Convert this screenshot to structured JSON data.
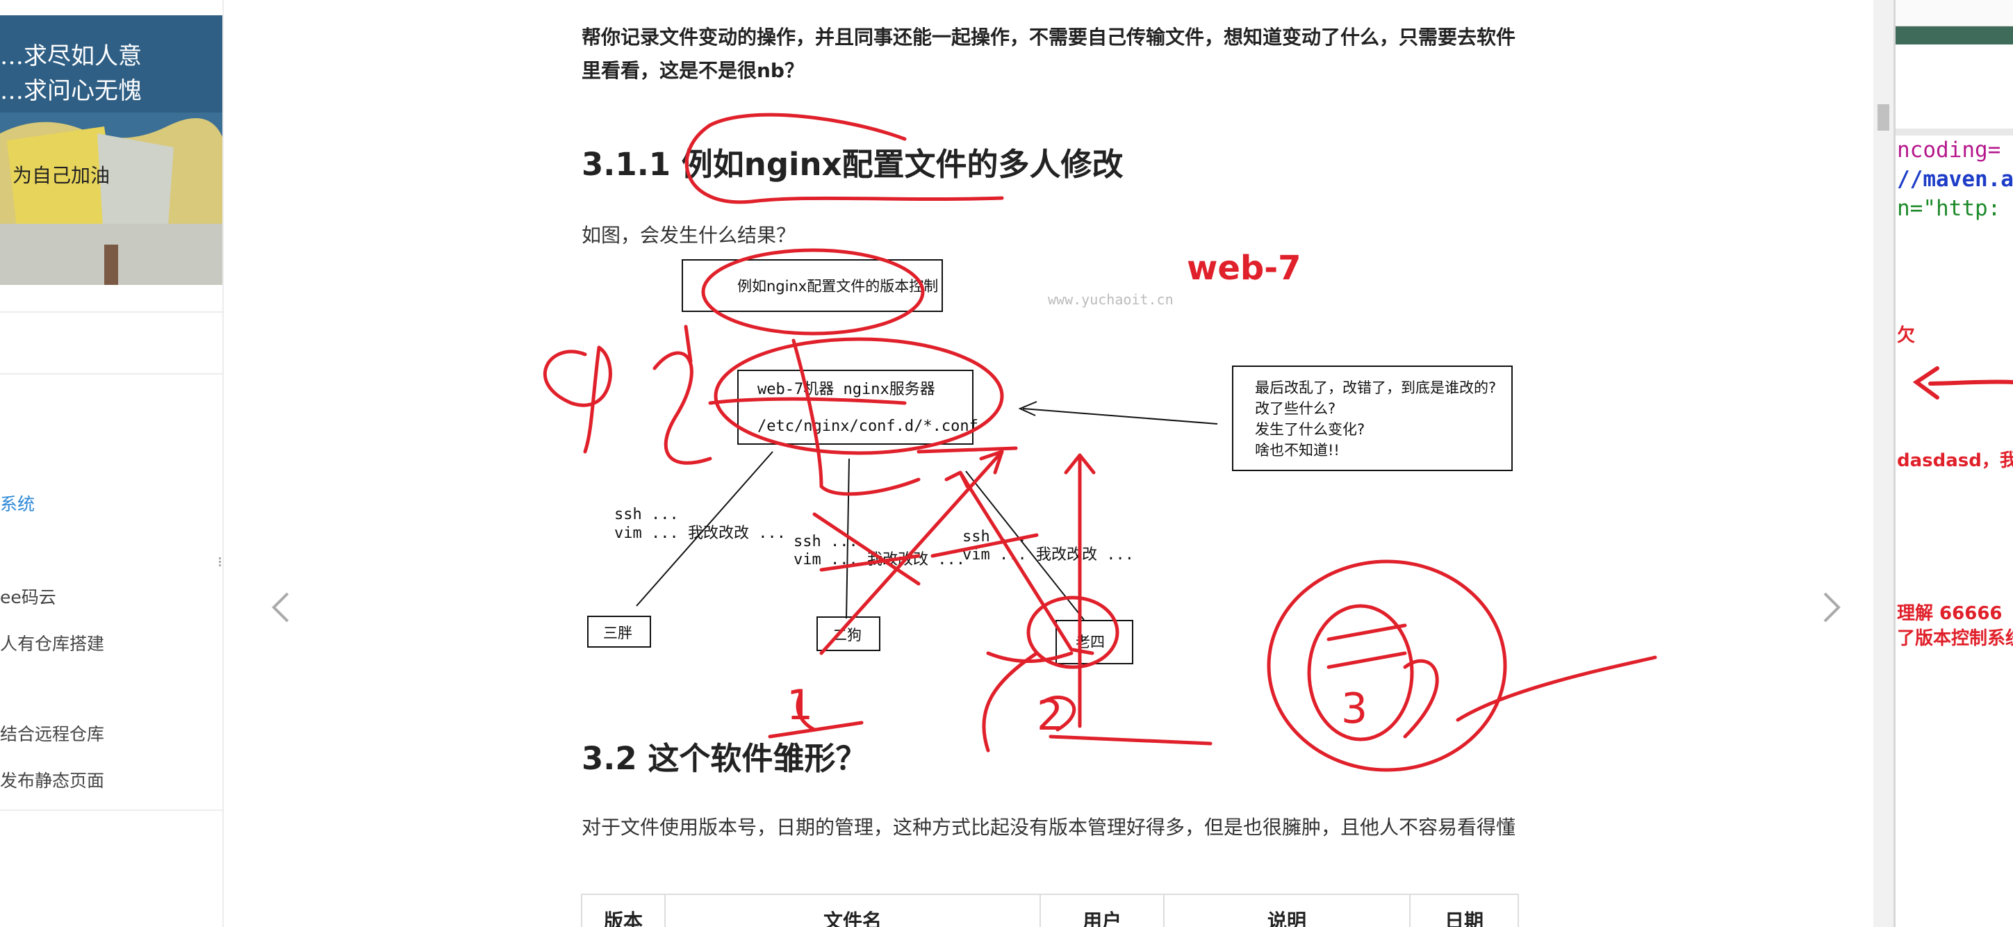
{
  "sidebar": {
    "items": [
      {
        "label": "系统",
        "active": true
      },
      {
        "label": "ee码云"
      },
      {
        "label": "人有仓库搭建"
      },
      {
        "label": "结合远程仓库"
      },
      {
        "label": "发布静态页面"
      }
    ]
  },
  "article": {
    "intro": "帮你记录文件变动的操作，并且同事还能一起操作，不需要自己传输文件，想知道变动了什么，只需要去软件里看看，这是不是很nb？",
    "heading_311": "3.1.1 例如nginx配置文件的多人修改",
    "question": "如图，会发生什么结果？",
    "figure": {
      "title_box": "例如nginx配置文件的版本控制",
      "watermark": "www.yuchaoit.cn",
      "server_line1": "web-7机器  nginx服务器",
      "server_line2": "/etc/nginx/conf.d/*.conf",
      "note_lines": [
        "最后改乱了，改错了，到底是谁改的?",
        "改了些什么?",
        "发生了什么变化?",
        "啥也不知道!!"
      ],
      "ssh_label": "ssh  ...",
      "vim_label": "vim  ... 我改改改 ...",
      "user1": "三胖",
      "user2": "二狗",
      "user3": "老四"
    },
    "annotations": {
      "web7": "web-7",
      "num1": "1",
      "num2": "2",
      "num3": "3"
    },
    "heading_32": "3.2 这个软件雏形？",
    "para_32": "对于文件使用版本号，日期的管理，这种方式比起没有版本管理好得多，但是也很臃肿，且他人不容易看得懂",
    "table_headers": [
      "版本",
      "文件名",
      "用户",
      "说明",
      "日期"
    ]
  },
  "right_window": {
    "code_lines": [
      "ncoding=",
      "//maven.a",
      "n=\"http:"
    ],
    "red_texts": [
      "欠",
      "dasdasd，我不",
      "理解 66666",
      "了版本控制系统"
    ]
  },
  "colors": {
    "annotation_red": "#e0202a",
    "link_blue": "#2b88d8",
    "fab_gray": "#6e6e6e"
  }
}
